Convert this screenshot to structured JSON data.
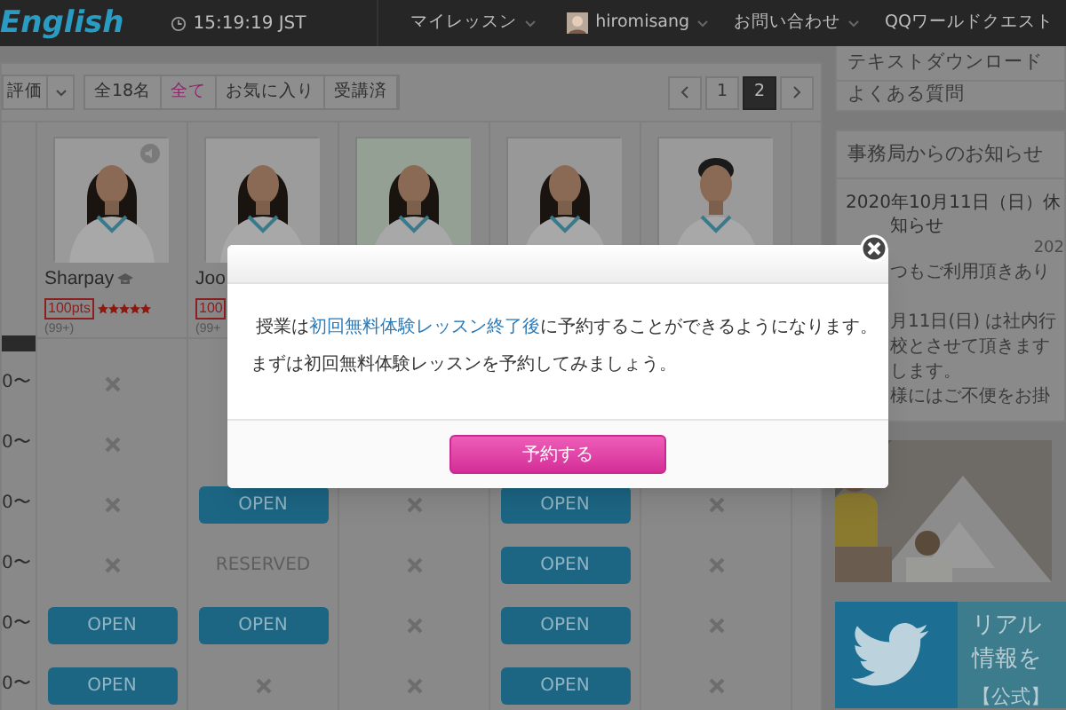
{
  "header": {
    "logo": "English",
    "time": "15:19:19 JST",
    "nav": [
      {
        "label": "マイレッスン",
        "kind": "menu"
      },
      {
        "label": "hiromisang",
        "kind": "user"
      },
      {
        "label": "お問い合わせ",
        "kind": "menu"
      },
      {
        "label": "QQワールドクエスト",
        "kind": "link"
      }
    ]
  },
  "filters": {
    "sort": "評価",
    "count": "全18名",
    "tabs": [
      {
        "label": "全て",
        "selected": true
      },
      {
        "label": "お気に入り",
        "selected": false
      },
      {
        "label": "受講済",
        "selected": false
      }
    ],
    "pages": [
      {
        "label": "1",
        "selected": false
      },
      {
        "label": "2",
        "selected": true
      }
    ]
  },
  "teachers": [
    {
      "name": "Sharpay",
      "pts": "100pts",
      "stars": 5,
      "reviews": "(99+)",
      "audio": true
    },
    {
      "name": "Joo",
      "pts": "100",
      "reviews": "(99+",
      "audio": false
    },
    {
      "audio": false
    },
    {
      "audio": false
    },
    {
      "audio": false
    }
  ],
  "rows": [
    {
      "time": "0〜",
      "cells": [
        {
          "kind": "x"
        },
        {
          "kind": "hidden"
        },
        {
          "kind": "hidden"
        },
        {
          "kind": "hidden"
        },
        {
          "kind": "hidden"
        }
      ]
    },
    {
      "time": "0〜",
      "cells": [
        {
          "kind": "x"
        },
        {
          "kind": "hidden"
        },
        {
          "kind": "hidden"
        },
        {
          "kind": "hidden"
        },
        {
          "kind": "hidden"
        }
      ]
    },
    {
      "time": "0〜",
      "cells": [
        {
          "kind": "x"
        },
        {
          "kind": "open",
          "label": "OPEN"
        },
        {
          "kind": "x"
        },
        {
          "kind": "open",
          "label": "OPEN"
        },
        {
          "kind": "x"
        }
      ]
    },
    {
      "time": "0〜",
      "cells": [
        {
          "kind": "x"
        },
        {
          "kind": "reserved",
          "label": "RESERVED"
        },
        {
          "kind": "x"
        },
        {
          "kind": "open",
          "label": "OPEN"
        },
        {
          "kind": "x"
        }
      ]
    },
    {
      "time": "0〜",
      "cells": [
        {
          "kind": "open",
          "label": "OPEN"
        },
        {
          "kind": "open",
          "label": "OPEN"
        },
        {
          "kind": "x"
        },
        {
          "kind": "open",
          "label": "OPEN"
        },
        {
          "kind": "x"
        }
      ]
    },
    {
      "time": "0〜",
      "cells": [
        {
          "kind": "open",
          "label": "OPEN"
        },
        {
          "kind": "x"
        },
        {
          "kind": "x"
        },
        {
          "kind": "open",
          "label": "OPEN"
        },
        {
          "kind": "x"
        }
      ]
    }
  ],
  "sidebar": {
    "links": [
      "テキストダウンロード",
      "よくある質問"
    ],
    "notice_title": "事務局からのお知らせ",
    "notice_heading": [
      "2020年10月11日（日）休",
      "知らせ"
    ],
    "notice_date": "202",
    "notice_lines": [
      "つもご利用頂きあり",
      "月11日(日) は社内行",
      "校とさせて頂きます",
      "します。",
      "様にはご不便をお掛"
    ],
    "banner": {
      "kind": "picture"
    },
    "twitter_lines": [
      "リアル",
      "情報を",
      "【公式】"
    ]
  },
  "modal": {
    "message_before": "授業は",
    "message_link": "初回無料体験レッスン終了後",
    "message_after": "に予約することができるようになります。",
    "message_2": "まずは初回無料体験レッスンを予約してみましょう。",
    "button": "予約する"
  }
}
